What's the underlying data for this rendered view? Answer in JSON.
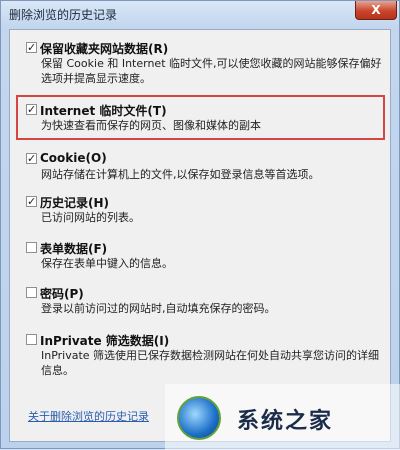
{
  "window": {
    "title": "删除浏览的历史记录",
    "close": "X"
  },
  "items": [
    {
      "checked": true,
      "label": "保留收藏夹网站数据(R)",
      "desc": "保留 Cookie 和 Internet 临时文件,可以使您收藏的网站能够保存偏好选项并提高显示速度。"
    },
    {
      "checked": true,
      "label": "Internet 临时文件(T)",
      "desc": "为快速查看而保存的网页、图像和媒体的副本"
    },
    {
      "checked": true,
      "label": "Cookie(O)",
      "desc": "网站存储在计算机上的文件,以保存如登录信息等首选项。"
    },
    {
      "checked": true,
      "label": "历史记录(H)",
      "desc": "已访问网站的列表。"
    },
    {
      "checked": false,
      "label": "表单数据(F)",
      "desc": "保存在表单中键入的信息。"
    },
    {
      "checked": false,
      "label": "密码(P)",
      "desc": "登录以前访问过的网站时,自动填充保存的密码。"
    },
    {
      "checked": false,
      "label": "InPrivate 筛选数据(I)",
      "desc": "InPrivate 筛选使用已保存数据检测网站在何处自动共享您访问的详细信息。"
    }
  ],
  "footer": {
    "link": "关于删除浏览的历史记录"
  },
  "watermark": {
    "text": "系统之家"
  }
}
